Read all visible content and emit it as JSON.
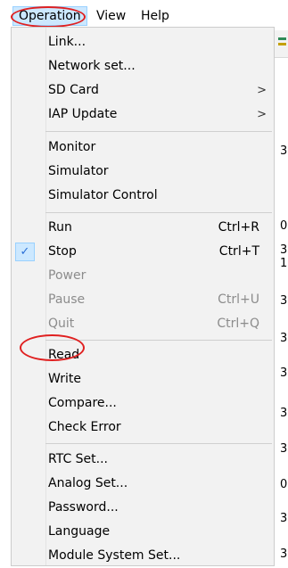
{
  "menubar": {
    "operation": "Operation",
    "view": "View",
    "help": "Help"
  },
  "background": {
    "glyphs": [
      "3",
      "0",
      "3",
      "1",
      "3",
      "3",
      "3",
      "3",
      "3",
      "0",
      "3",
      "3"
    ]
  },
  "menu": {
    "link": "Link...",
    "network_set": "Network set...",
    "sd_card": "SD Card",
    "iap_update": "IAP Update",
    "submenu_arrow": ">",
    "monitor": "Monitor",
    "simulator": "Simulator",
    "simulator_control": "Simulator Control",
    "run": "Run",
    "run_shortcut": "Ctrl+R",
    "stop": "Stop",
    "stop_shortcut": "Ctrl+T",
    "stop_checked": true,
    "power": "Power",
    "pause": "Pause",
    "pause_shortcut": "Ctrl+U",
    "quit": "Quit",
    "quit_shortcut": "Ctrl+Q",
    "read": "Read",
    "write": "Write",
    "compare": "Compare...",
    "check_error": "Check Error",
    "rtc_set": "RTC Set...",
    "analog_set": "Analog Set...",
    "password": "Password...",
    "language": "Language",
    "module_system_set": "Module System Set..."
  },
  "colors": {
    "highlight": "#cce8ff",
    "annotation": "#e02020",
    "menu_bg": "#f2f2f2",
    "disabled_text": "#8c8c8c"
  },
  "icons": {
    "check": "check-icon",
    "submenu": "chevron-right-icon"
  }
}
